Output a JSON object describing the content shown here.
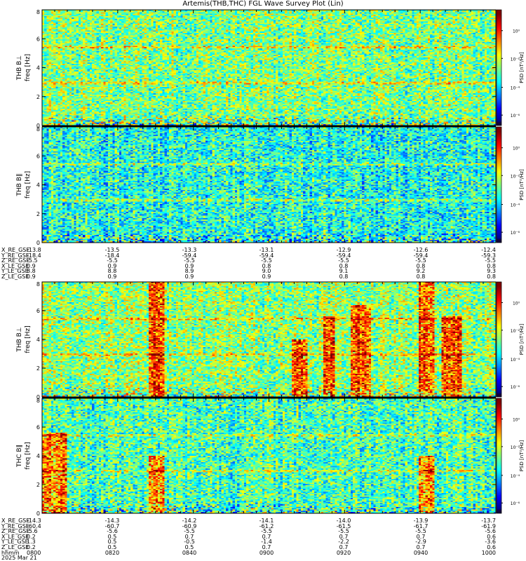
{
  "title": "Artemis(THB,THC) FGL Wave Survey Plot (Lin)",
  "colors": {
    "frame": "#000000",
    "background": "#ffffff"
  },
  "chart_data": [
    {
      "type": "heatmap",
      "block": 0,
      "panels": [
        {
          "name": "THB B⊥",
          "ylabel_top": "THB B⊥",
          "ylabel_bottom": "freq [Hz]",
          "ylim": [
            0,
            8
          ],
          "yticks": [
            "0",
            "2",
            "4",
            "6",
            "8"
          ],
          "cbar_label": "PSD [nT²/Hz]",
          "cbar_ticks": [
            "10⁰",
            "10⁻²",
            "10⁻⁴",
            "10⁻⁶"
          ],
          "mean_level": 0.5,
          "bright_bursts": []
        },
        {
          "name": "THB B∥",
          "ylabel_top": "THB B∥",
          "ylabel_bottom": "freq [Hz]",
          "ylim": [
            0,
            8
          ],
          "yticks": [
            "0",
            "2",
            "4",
            "6",
            "8"
          ],
          "cbar_label": "PSD [nT²/Hz]",
          "cbar_ticks": [
            "10⁰",
            "10⁻²",
            "10⁻⁴",
            "10⁻⁶"
          ],
          "mean_level": 0.4,
          "bright_bursts": []
        }
      ],
      "ephemeris_labels": [
        "X_RE_GSE",
        "Y_RE_GSE",
        "Z_RE_GSE",
        "X_LE_GSE",
        "Y_LE_GSE",
        "Z_LE_GSE"
      ],
      "ephemeris_columns": [
        [
          "-13.8",
          "-18.4",
          "-5.5",
          "0.9",
          "8.8",
          "0.9"
        ],
        [
          "-13.5",
          "-18.4",
          "-5.5",
          "0.9",
          "8.8",
          "0.9"
        ],
        [
          "-13.3",
          "-59.4",
          "-5.5",
          "0.9",
          "8.9",
          "0.9"
        ],
        [
          "-13.1",
          "-59.4",
          "-5.5",
          "0.8",
          "9.0",
          "0.9"
        ],
        [
          "-12.9",
          "-59.4",
          "-5.5",
          "0.8",
          "9.1",
          "0.8"
        ],
        [
          "-12.6",
          "-59.4",
          "-5.5",
          "0.8",
          "9.2",
          "0.8"
        ],
        [
          "-12.4",
          "-59.3",
          "-5.5",
          "0.8",
          "9.3",
          "0.8"
        ]
      ]
    },
    {
      "type": "heatmap",
      "block": 1,
      "panels": [
        {
          "name": "THB B⊥",
          "ylabel_top": "THB B⊥",
          "ylabel_bottom": "freq [Hz]",
          "ylim": [
            0,
            8
          ],
          "yticks": [
            "0",
            "2",
            "4",
            "6",
            "8"
          ],
          "cbar_label": "PSD [nT²/Hz]",
          "cbar_ticks": [
            "10⁰",
            "10⁻²",
            "10⁻⁴",
            "10⁻⁶"
          ],
          "mean_level": 0.52,
          "bright_bursts": [
            [
              0.235,
              0.265,
              1.0
            ],
            [
              0.55,
              0.58,
              0.5
            ],
            [
              0.62,
              0.64,
              0.7
            ],
            [
              0.68,
              0.72,
              0.8
            ],
            [
              0.83,
              0.86,
              1.0
            ],
            [
              0.88,
              0.92,
              0.7
            ]
          ]
        },
        {
          "name": "THC B∥",
          "ylabel_top": "THC B∥",
          "ylabel_bottom": "freq [Hz]",
          "ylim": [
            0,
            8
          ],
          "yticks": [
            "0",
            "2",
            "4",
            "6",
            "8"
          ],
          "cbar_label": "PSD [nT²/Hz]",
          "cbar_ticks": [
            "10⁰",
            "10⁻²",
            "10⁻⁴",
            "10⁻⁶"
          ],
          "mean_level": 0.45,
          "bright_bursts": [
            [
              0.0,
              0.05,
              0.7
            ],
            [
              0.235,
              0.265,
              0.5
            ],
            [
              0.83,
              0.86,
              0.5
            ]
          ]
        }
      ],
      "ephemeris_labels": [
        "X_RE_GSE",
        "Y_RE_GSE",
        "Z_RE_GSE",
        "X_LE_GSE",
        "Y_LE_GSE",
        "Z_LE_GSE",
        "hhmm"
      ],
      "ephemeris_columns": [
        [
          "-14.3",
          "-60.4",
          "-5.6",
          "0.2",
          "1.3",
          "0.2",
          "0800"
        ],
        [
          "-14.3",
          "-60.7",
          "-5.6",
          "0.5",
          "0.5",
          "0.5",
          "0820"
        ],
        [
          "-14.2",
          "-60.9",
          "-5.5",
          "0.7",
          "-0.5",
          "0.5",
          "0840"
        ],
        [
          "-14.1",
          "-61.2",
          "-5.5",
          "0.7",
          "-1.4",
          "0.7",
          "0900"
        ],
        [
          "-14.0",
          "-61.5",
          "-5.5",
          "0.7",
          "-2.2",
          "0.7",
          "0920"
        ],
        [
          "-13.9",
          "-61.7",
          "-5.5",
          "0.7",
          "-2.9",
          "0.7",
          "0940"
        ],
        [
          "-13.7",
          "-61.9",
          "-5.6",
          "0.6",
          "-3.6",
          "0.6",
          "1000"
        ]
      ],
      "date": "2025 Mar 21"
    }
  ]
}
